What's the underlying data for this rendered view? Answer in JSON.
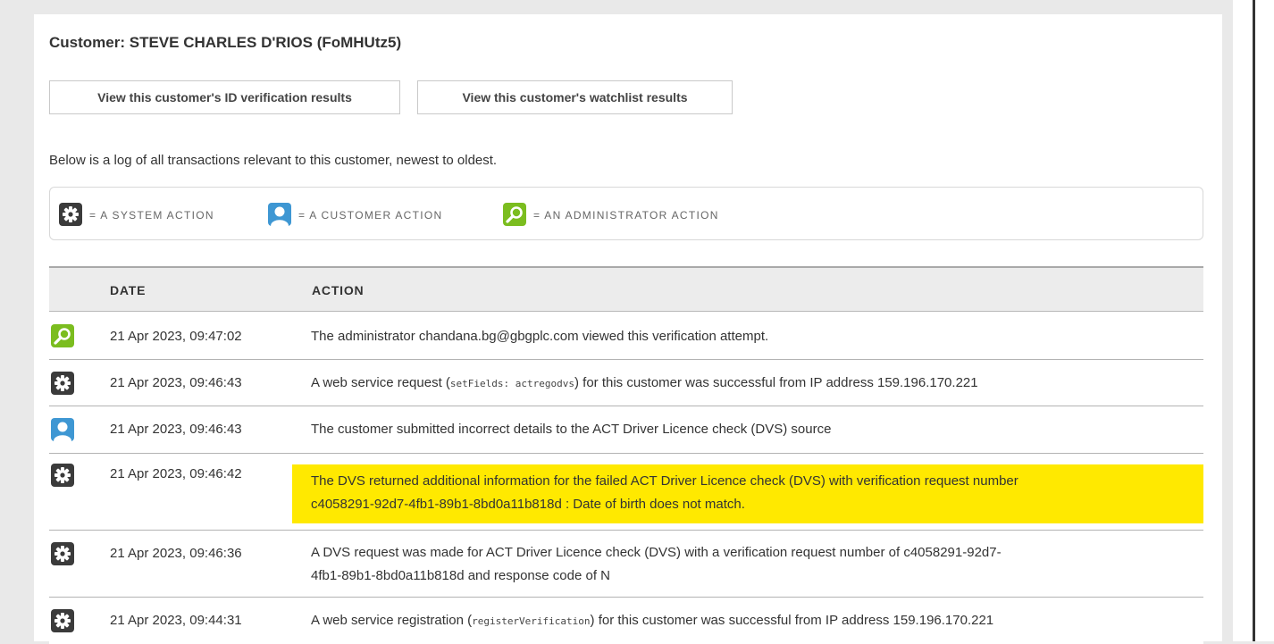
{
  "customer": {
    "title": "Customer: STEVE CHARLES D'RIOS (FoMHUtz5)",
    "id_button": "View this customer's ID verification results",
    "watchlist_button": "View this customer's watchlist results",
    "intro": "Below is a log of all transactions relevant to this customer, newest to oldest."
  },
  "legend": {
    "system": "= A SYSTEM ACTION",
    "customer": "= A CUSTOMER ACTION",
    "admin": "= AN ADMINISTRATOR ACTION"
  },
  "table": {
    "headers": {
      "date": "DATE",
      "action": "ACTION"
    },
    "rows": [
      {
        "type": "admin-icon",
        "date": "21 Apr 2023, 09:47:02",
        "action": "The administrator chandana.bg@gbgplc.com viewed this verification attempt."
      },
      {
        "type": "system-icon",
        "date": "21 Apr 2023, 09:46:43",
        "action_pre": "A web service request (",
        "action_code": "setFields: actregodvs",
        "action_post": ") for this customer was successful from IP address 159.196.170.221"
      },
      {
        "type": "customer-icon",
        "date": "21 Apr 2023, 09:46:43",
        "action": "The customer submitted incorrect details to the ACT Driver Licence check (DVS) source"
      },
      {
        "type": "system-icon",
        "date": "21 Apr 2023, 09:46:42",
        "action_line1": "The DVS returned additional information for the failed ACT Driver Licence check (DVS) with verification request number",
        "action_line2": "c4058291-92d7-4fb1-89b1-8bd0a11b818d : Date of birth does not match.",
        "highlight_color": "#ffe900"
      },
      {
        "type": "system-icon",
        "date": "21 Apr 2023, 09:46:36",
        "action_line1": "A DVS request was made for ACT Driver Licence check (DVS) with a verification request number of c4058291-92d7-",
        "action_line2": "4fb1-89b1-8bd0a11b818d and response code of N"
      },
      {
        "type": "system-icon",
        "date": "21 Apr 2023, 09:44:31",
        "action_pre": "A web service registration (",
        "action_code": "registerVerification",
        "action_post": ") for this customer was successful from IP address 159.196.170.221"
      }
    ]
  },
  "colors": {
    "system_icon": "#3b3b3b",
    "customer_icon": "#3e97d3",
    "admin_icon": "#7bbd1f",
    "highlight": "#ffe900"
  }
}
